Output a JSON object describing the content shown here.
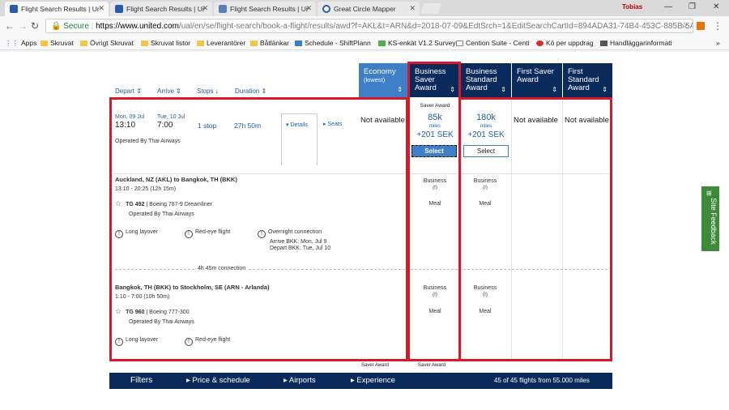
{
  "browser": {
    "tabs": [
      {
        "title": "Flight Search Results | Ur",
        "active": true
      },
      {
        "title": "Flight Search Results | Ur",
        "active": false
      },
      {
        "title": "Flight Search Results | Ur",
        "active": false
      },
      {
        "title": "Great Circle Mapper",
        "active": false
      }
    ],
    "user": "Tobias",
    "url": {
      "secure_label": "Secure",
      "host": "https://www.united.com",
      "path": "/ual/en/se/flight-search/book-a-flight/results/awd?f=AKL&t=ARN&d=2018-07-09&EdtSrch=1&EditSearchCartId=894ADA31-74B4-453C-885B-5A2CC..."
    },
    "bookmarks": [
      {
        "label": "Apps",
        "icon": "apps-icon"
      },
      {
        "label": "Skruvat",
        "icon": "folder-icon"
      },
      {
        "label": "Övrigt Skruvat",
        "icon": "folder-icon"
      },
      {
        "label": "Skruvat listor",
        "icon": "folder-icon"
      },
      {
        "label": "Leverantörer",
        "icon": "folder-icon"
      },
      {
        "label": "Båtlänkar",
        "icon": "folder-icon"
      },
      {
        "label": "Schedule - ShiftPlann",
        "icon": "shiftplan-icon"
      },
      {
        "label": "KS-enkät V1.2 Survey",
        "icon": "survey-icon"
      },
      {
        "label": "Cention Suite - Centi",
        "icon": "page-icon"
      },
      {
        "label": "Kö per uppdrag",
        "icon": "queue-icon"
      },
      {
        "label": "Handläggarinformati",
        "icon": "info-icon"
      }
    ],
    "more": "»"
  },
  "sort": {
    "depart": "Depart",
    "arrive": "Arrive",
    "stops": "Stops",
    "duration": "Duration"
  },
  "columns": [
    {
      "line1": "Economy",
      "line2": "(lowest)",
      "color": "#3f7fc8"
    },
    {
      "line1": "Business",
      "line2": "Saver",
      "line3": "Award",
      "color": "#0b2a5c"
    },
    {
      "line1": "Business",
      "line2": "Standard",
      "line3": "Award",
      "color": "#0b2a5c"
    },
    {
      "line1": "First Saver",
      "line2": "Award",
      "color": "#0b2a5c"
    },
    {
      "line1": "First",
      "line2": "Standard",
      "line3": "Award",
      "color": "#0b2a5c"
    }
  ],
  "flight": {
    "depart_date": "Mon, 09 Jul",
    "depart_time": "13:10",
    "arrive_date": "Tue, 10 Jul",
    "arrive_time": "7:00",
    "stops": "1 stop",
    "duration": "27h 50m",
    "operated": "Operated By Thai Airways",
    "details_label": "Details",
    "seats_label": "Seats",
    "economy": "Not available",
    "saver_tag": "Saver Award",
    "saver_miles": "85k",
    "saver_miles_unit": "miles",
    "saver_tax": "+201 SEK",
    "saver_select": "Select",
    "standard_miles": "180k",
    "standard_miles_unit": "miles",
    "standard_tax": "+201 SEK",
    "standard_select": "Select",
    "first_saver": "Not available",
    "first_standard": "Not available"
  },
  "segments": [
    {
      "route": "Auckland, NZ (AKL) to Bangkok, TH (BKK)",
      "time": "13:10 - 20:25 (12h 15m)",
      "flight_no": "TG 492",
      "aircraft": "Boeing 787-9 Dreamliner",
      "operated": "Operated By Thai Airways",
      "warning1": "Long layover",
      "warning2": "Red-eye flight",
      "overnight1": "Overnight connection",
      "overnight2": "Arrive BKK: Mon, Jul 9",
      "overnight3": "Depart BKK: Tue, Jul 10",
      "saver_cabin": "Business",
      "saver_code": "(I)",
      "saver_meal": "Meal",
      "standard_cabin": "Business",
      "standard_code": "(I)",
      "standard_meal": "Meal"
    },
    {
      "route": "Bangkok, TH (BKK) to Stockholm, SE (ARN - Arlanda)",
      "time": "1:10 - 7:00 (10h 50m)",
      "flight_no": "TG 960",
      "aircraft": "Boeing 777-300",
      "operated": "Operated By Thai Airways",
      "warning1": "Long layover",
      "warning2": "Red-eye flight",
      "saver_cabin": "Business",
      "saver_code": "(I)",
      "saver_meal": "Meal",
      "standard_cabin": "Business",
      "standard_code": "(I)",
      "standard_meal": "Meal"
    }
  ],
  "connection": "4h 45m connection",
  "footer_tags": [
    "Saver Award",
    "Saver Award"
  ],
  "filters": {
    "title": "Filters",
    "price": "Price & schedule",
    "airports": "Airports",
    "experience": "Experience",
    "count": "45 of 45 flights from 55.000 miles"
  },
  "feedback": "Site Feedback",
  "colors": {
    "highlight": "#d7192a",
    "navy": "#0b2a5c",
    "economy": "#3f7fc8",
    "link": "#1f5fa8"
  }
}
